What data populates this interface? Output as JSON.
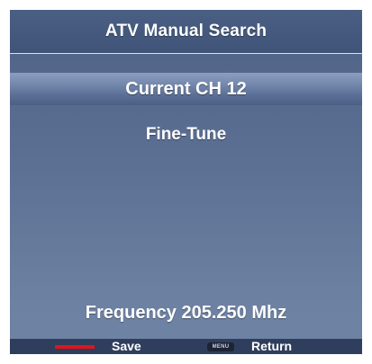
{
  "osd": {
    "title": "ATV Manual Search",
    "current_channel": "Current CH 12",
    "fine_tune": "Fine-Tune",
    "frequency": "Frequency 205.250 Mhz"
  },
  "footer": {
    "save_label": "Save",
    "menu_key_label": "MENU",
    "return_label": "Return"
  },
  "colors": {
    "panel": "#5b6f92",
    "title_bar": "#44597d",
    "footer": "#2f3e5c",
    "red_key": "#e0151b",
    "text": "#ffffff"
  },
  "icons": {
    "red_key": "red-color-key-icon",
    "menu_key": "menu-key-icon"
  }
}
